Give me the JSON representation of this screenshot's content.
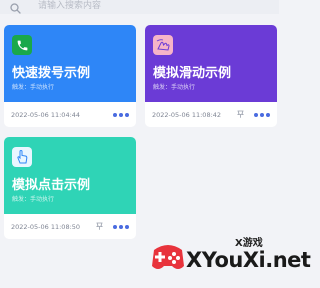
{
  "search": {
    "placeholder": "请输入搜索内容",
    "icon": "search-icon"
  },
  "cards": [
    {
      "title": "快速拨号示例",
      "subtitle": "触发：手动执行",
      "date": "2022-05-06 11:04:44",
      "icon": "phone-icon",
      "banner_color": "#2e86f7",
      "pinned": false
    },
    {
      "title": "模拟滑动示例",
      "subtitle": "触发：手动执行",
      "date": "2022-05-06 11:08:42",
      "icon": "swipe-hand-icon",
      "banner_color": "#6b3bd6",
      "pinned": true
    },
    {
      "title": "模拟点击示例",
      "subtitle": "触发：手动执行",
      "date": "2022-05-06 11:08:50",
      "icon": "tap-hand-icon",
      "banner_color": "#2fd4b6",
      "pinned": true
    }
  ],
  "watermark": {
    "small": "X游戏",
    "big": "XYouXi.net"
  }
}
